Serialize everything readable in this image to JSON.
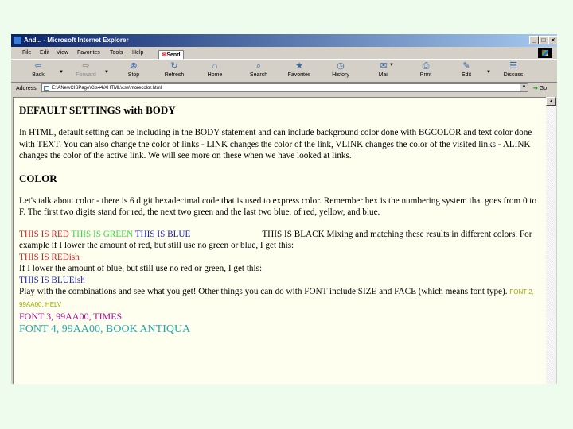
{
  "window": {
    "title": "And... - Microsoft Internet Explorer",
    "controls": {
      "minimize": "_",
      "maximize": "□",
      "close": "×"
    }
  },
  "menu": [
    "File",
    "Edit",
    "View",
    "Favorites",
    "Tools",
    "Help"
  ],
  "send_label": "Send",
  "toolbar": [
    {
      "label": "Back",
      "icon": "back-arrow-icon"
    },
    {
      "label": "Forward",
      "icon": "forward-arrow-icon",
      "disabled": true
    },
    {
      "label": "Stop",
      "icon": "stop-icon"
    },
    {
      "label": "Refresh",
      "icon": "refresh-icon"
    },
    {
      "label": "Home",
      "icon": "home-icon"
    },
    {
      "label": "Search",
      "icon": "search-icon"
    },
    {
      "label": "Favorites",
      "icon": "favorites-icon"
    },
    {
      "label": "History",
      "icon": "history-icon"
    },
    {
      "label": "Mail",
      "icon": "mail-icon"
    },
    {
      "label": "Print",
      "icon": "print-icon"
    },
    {
      "label": "Edit",
      "icon": "edit-icon"
    },
    {
      "label": "Discuss",
      "icon": "discuss-icon"
    }
  ],
  "address": {
    "label": "Address",
    "url": "E:\\ANewCISPage\\Cis44\\XHTML\\css\\morecolor.html",
    "go_label": "Go"
  },
  "content": {
    "h1": "DEFAULT SETTINGS with BODY",
    "p1": "In HTML, default setting can be including in the BODY statement and can include background color done with BGCOLOR and text color done with TEXT. You can also change the color of links - LINK changes the color of the link, VLINK changes the color of the visited links - ALINK changes the color of the active link. We will see more on these when we have looked at links.",
    "h2": "COLOR",
    "p2": "Let's talk about color - there is 6 digit hexadecimal code that is used to express color. Remember hex is the numbering system that goes from 0 to F. The first two digits stand for red, the next two green and the last two blue. of red, yellow, and blue.",
    "red_text": "THIS IS RED",
    "green_text": "THIS IS GREEN",
    "blue_text": "THIS IS BLUE",
    "black_text": "THIS IS BLACK Mixing and matching these results in different colors. For example if I lower the amount of red, but still use no green or blue, I get this:",
    "redish": "THIS IS REDish",
    "lower_blue": "If I lower the amount of blue, but still use no red or green, I get this:",
    "blueish": "THIS IS BLUEish",
    "play": "Play with the combinations and see what you get! Other things you can do with FONT include SIZE and FACE (which means font type).",
    "font2": "FONT 2, 99AA00, HELV",
    "font3": "FONT 3, 99AA00, TIMES",
    "font4": "FONT 4, 99AA00, BOOK ANTIQUA"
  },
  "colors": {
    "red": "#cc2020",
    "green": "#3dd13d",
    "blue": "#1a1ab8",
    "font2": "#99aa00",
    "font3": "#aa1199",
    "font4": "#25a7a7",
    "page_bg": "#fffff0"
  }
}
